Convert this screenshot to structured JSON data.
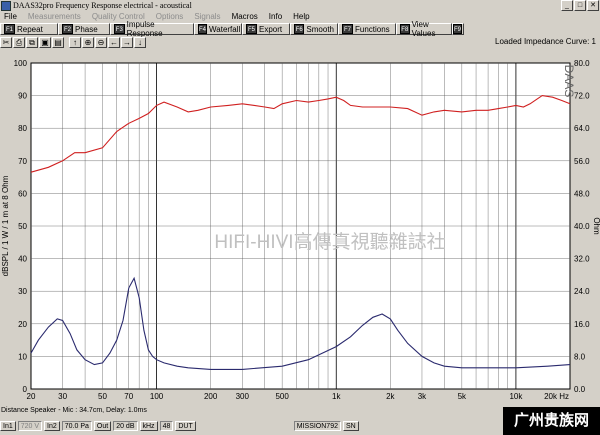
{
  "window": {
    "title": "DAAS32pro Frequency Response electrical - acoustical",
    "btn_min": "_",
    "btn_max": "□",
    "btn_close": "✕"
  },
  "menu": [
    {
      "label": "File",
      "disabled": false
    },
    {
      "label": "Measurements",
      "disabled": true
    },
    {
      "label": "Quality Control",
      "disabled": true
    },
    {
      "label": "Options",
      "disabled": true
    },
    {
      "label": "Signals",
      "disabled": true
    },
    {
      "label": "Macros",
      "disabled": false
    },
    {
      "label": "Info",
      "disabled": false
    },
    {
      "label": "Help",
      "disabled": false
    }
  ],
  "fkeys": [
    {
      "key": "F1",
      "label": "Repeat"
    },
    {
      "key": "F2",
      "label": "Phase"
    },
    {
      "key": "F3",
      "label": "Impulse Response"
    },
    {
      "key": "F4",
      "label": "Waterfall"
    },
    {
      "key": "F5",
      "label": "Export"
    },
    {
      "key": "F6",
      "label": "Smooth"
    },
    {
      "key": "F7",
      "label": "Functions"
    },
    {
      "key": "F8",
      "label": "View Values"
    },
    {
      "key": "F9",
      "label": ""
    }
  ],
  "toolbar": {
    "curve_label": "Loaded Impedance Curve: 1"
  },
  "chart_data": {
    "type": "line",
    "xscale": "log",
    "xlim": [
      20,
      20000
    ],
    "x_tick_values": [
      20,
      30,
      50,
      70,
      100,
      200,
      300,
      500,
      1000,
      2000,
      3000,
      5000,
      10000,
      20000
    ],
    "x_tick_labels": [
      "20",
      "30",
      "50",
      "70",
      "100",
      "200",
      "300",
      "500",
      "1k",
      "2k",
      "3k",
      "5k",
      "10k",
      "20k Hz"
    ],
    "ylabel": "dBSPL / 1 W / 1 m at 8 Ohm",
    "ylim": [
      0,
      100
    ],
    "y_ticks": [
      0,
      10,
      20,
      30,
      40,
      50,
      60,
      70,
      80,
      90,
      100
    ],
    "y2label": "Ohm",
    "y2lim": [
      0,
      96
    ],
    "y2_tick_labels": [
      "0.0",
      "8.0",
      "16.0",
      "24.0",
      "32.0",
      "40.0",
      "48.0",
      "56.0",
      "64.0",
      "72.0",
      "80.0"
    ],
    "logo": "DAAS",
    "watermark": "HIFI-HIVI高傳真視聽雜誌社",
    "grid": true,
    "series": [
      {
        "color": "#d02020",
        "x": [
          20,
          25,
          30,
          35,
          40,
          50,
          60,
          70,
          80,
          90,
          100,
          110,
          130,
          150,
          170,
          200,
          250,
          300,
          350,
          400,
          450,
          500,
          600,
          700,
          800,
          900,
          1000,
          1100,
          1200,
          1400,
          1600,
          2000,
          2500,
          3000,
          3500,
          4000,
          5000,
          6000,
          7000,
          8000,
          9000,
          10000,
          11000,
          12000,
          14000,
          16000,
          18000,
          20000
        ],
        "y": [
          66.5,
          68,
          70,
          72.5,
          72.5,
          74,
          79,
          81.5,
          83,
          84.5,
          87,
          88,
          86.5,
          85,
          85.5,
          86.5,
          87,
          87.5,
          87,
          86.5,
          86,
          87.5,
          88.5,
          88,
          88.5,
          89,
          89.5,
          88.5,
          87,
          86.5,
          86.5,
          86.5,
          86,
          84,
          85,
          85.5,
          85,
          85.5,
          85.5,
          86,
          86.5,
          87,
          86.5,
          87.5,
          90,
          89.5,
          88.5,
          87.5
        ]
      },
      {
        "color": "#2a2a6e",
        "x": [
          20,
          22,
          25,
          28,
          30,
          33,
          36,
          40,
          45,
          50,
          55,
          60,
          65,
          70,
          75,
          80,
          85,
          90,
          95,
          100,
          110,
          130,
          150,
          200,
          300,
          500,
          700,
          1000,
          1200,
          1400,
          1600,
          1800,
          2000,
          2200,
          2500,
          3000,
          3500,
          4000,
          5000,
          7000,
          10000,
          15000,
          20000
        ],
        "y": [
          11,
          15,
          19,
          21.5,
          21,
          17,
          12,
          9,
          7.5,
          8,
          11,
          15,
          21,
          31,
          34,
          28,
          18,
          12,
          10,
          9,
          8,
          7,
          6.5,
          6,
          6,
          7,
          9,
          13,
          16,
          19.5,
          22,
          23,
          21.5,
          18,
          14,
          10,
          8,
          7,
          6.5,
          6.5,
          6.5,
          7,
          7.5
        ]
      }
    ]
  },
  "status": {
    "line1": "Distance Speaker - Mic : 34.7cm, Delay: 1.0ms",
    "in1": "In1",
    "voltage": "720 V",
    "in2": "In2",
    "pa": "70.0 Pa",
    "out": "Out",
    "db": "20 dB",
    "khz": "kHz",
    "n48": "48",
    "dut": "DUT",
    "mission": "MISSION792",
    "sn": "SN",
    "brand": "广州贵族网"
  }
}
